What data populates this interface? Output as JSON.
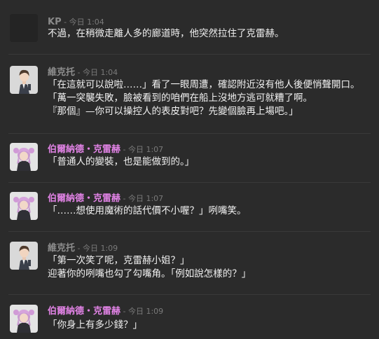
{
  "colors": {
    "background": "#2b2b2b",
    "kp": "#8a8a8a",
    "vic": "#8e8e8e",
    "bel": "#e283e6",
    "timestamp": "#7a7a7a"
  },
  "messages": [
    {
      "author": "KP",
      "sep": " - ",
      "timestamp": "今日 1:04",
      "avatar": "blank-avatar",
      "lines": [
        "不過，在稍微走離人多的廊道時，他突然拉住了克雷赫。"
      ]
    },
    {
      "author": "維克托",
      "sep": " - ",
      "timestamp": "今日 1:04",
      "avatar": "male-character-avatar",
      "lines": [
        "「在這就可以說啦……」看了一眼周遭，確認附近沒有他人後便悄聲開口。",
        "「萬一突襲失敗，臉被看到的咱們在船上沒地方逃可就糟了啊。",
        "『那個』—你可以操控人的表皮對吧？先變個臉再上場吧。」"
      ]
    },
    {
      "author": "伯爾納德・克雷赫",
      "sep": " - ",
      "timestamp": "今日 1:07",
      "avatar": "female-character-avatar",
      "lines": [
        "「普通人的變裝，也是能做到的。」"
      ]
    },
    {
      "author": "伯爾納德・克雷赫",
      "sep": " - ",
      "timestamp": "今日 1:07",
      "avatar": "female-character-avatar",
      "lines": [
        "「……想使用魔術的話代價不小喔？」咧嘴笑。"
      ]
    },
    {
      "author": "維克托",
      "sep": " - ",
      "timestamp": "今日 1:09",
      "avatar": "male-character-avatar",
      "lines": [
        "「第一次笑了呢，克雷赫小姐？」",
        "迎著你的咧嘴也勾了勾嘴角。「例如說怎樣的？」"
      ]
    },
    {
      "author": "伯爾納德・克雷赫",
      "sep": " - ",
      "timestamp": "今日 1:09",
      "avatar": "female-character-avatar",
      "lines": [
        "「你身上有多少錢？」"
      ]
    }
  ]
}
